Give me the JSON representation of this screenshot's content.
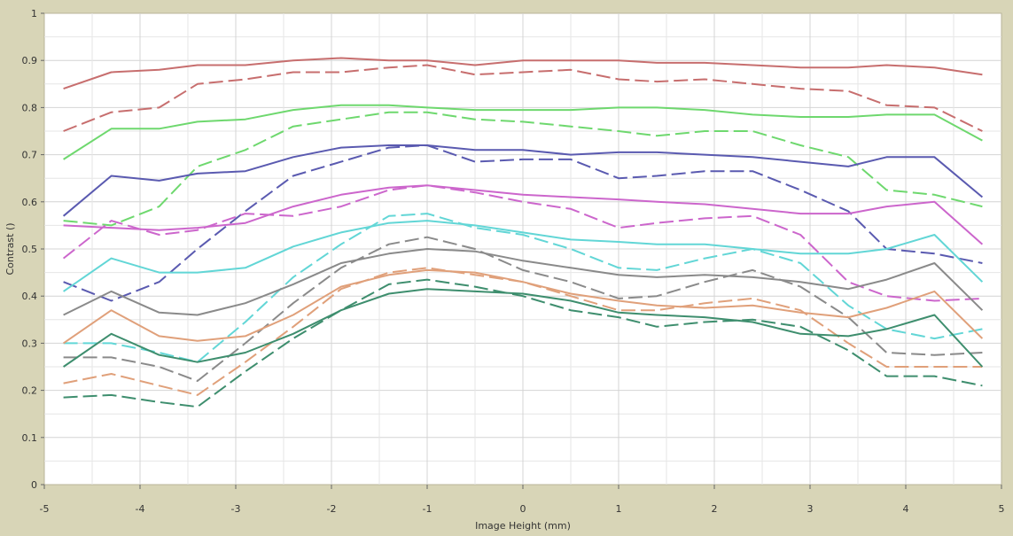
{
  "chart_data": {
    "type": "line",
    "title": "",
    "xlabel": "Image Height (mm)",
    "ylabel": "Contrast ()",
    "xlim": [
      -5,
      5
    ],
    "ylim": [
      0,
      1
    ],
    "x_ticks": [
      "-5",
      "-4",
      "-3",
      "-2",
      "-1",
      "0",
      "1",
      "2",
      "3",
      "4",
      "5"
    ],
    "y_ticks": [
      "0",
      "0.1",
      "0.2",
      "0.3",
      "0.4",
      "0.5",
      "0.6",
      "0.7",
      "0.8",
      "0.9",
      "1"
    ],
    "grid": true,
    "legend": "none",
    "x": [
      -4.8,
      -4.3,
      -3.8,
      -3.4,
      -2.9,
      -2.4,
      -1.9,
      -1.4,
      -1.0,
      -0.5,
      0.0,
      0.5,
      1.0,
      1.4,
      1.9,
      2.4,
      2.9,
      3.4,
      3.8,
      4.3,
      4.8
    ],
    "series": [
      {
        "color": "#c76e6e",
        "dash": false,
        "values": [
          0.84,
          0.875,
          0.88,
          0.89,
          0.89,
          0.9,
          0.905,
          0.9,
          0.9,
          0.89,
          0.9,
          0.9,
          0.9,
          0.895,
          0.895,
          0.89,
          0.885,
          0.885,
          0.89,
          0.885,
          0.87
        ]
      },
      {
        "color": "#c76e6e",
        "dash": true,
        "values": [
          0.75,
          0.79,
          0.8,
          0.85,
          0.86,
          0.875,
          0.875,
          0.885,
          0.89,
          0.87,
          0.875,
          0.88,
          0.86,
          0.855,
          0.86,
          0.85,
          0.84,
          0.835,
          0.805,
          0.8,
          0.75
        ]
      },
      {
        "color": "#6ed86e",
        "dash": false,
        "values": [
          0.69,
          0.755,
          0.755,
          0.77,
          0.775,
          0.795,
          0.805,
          0.805,
          0.8,
          0.795,
          0.795,
          0.795,
          0.8,
          0.8,
          0.795,
          0.785,
          0.78,
          0.78,
          0.785,
          0.785,
          0.73
        ]
      },
      {
        "color": "#6ed86e",
        "dash": true,
        "values": [
          0.56,
          0.55,
          0.59,
          0.675,
          0.71,
          0.76,
          0.775,
          0.79,
          0.79,
          0.775,
          0.77,
          0.76,
          0.75,
          0.74,
          0.75,
          0.75,
          0.72,
          0.695,
          0.625,
          0.615,
          0.59
        ]
      },
      {
        "color": "#5a5ab0",
        "dash": false,
        "values": [
          0.57,
          0.655,
          0.645,
          0.66,
          0.665,
          0.695,
          0.715,
          0.72,
          0.72,
          0.71,
          0.71,
          0.7,
          0.705,
          0.705,
          0.7,
          0.695,
          0.685,
          0.675,
          0.695,
          0.695,
          0.61
        ]
      },
      {
        "color": "#5a5ab0",
        "dash": true,
        "values": [
          0.43,
          0.39,
          0.43,
          0.5,
          0.58,
          0.655,
          0.685,
          0.715,
          0.72,
          0.685,
          0.69,
          0.69,
          0.65,
          0.655,
          0.665,
          0.665,
          0.625,
          0.58,
          0.5,
          0.49,
          0.47
        ]
      },
      {
        "color": "#cc66cc",
        "dash": false,
        "values": [
          0.55,
          0.545,
          0.54,
          0.545,
          0.555,
          0.59,
          0.615,
          0.63,
          0.635,
          0.625,
          0.615,
          0.61,
          0.605,
          0.6,
          0.595,
          0.585,
          0.575,
          0.575,
          0.59,
          0.6,
          0.51
        ]
      },
      {
        "color": "#cc66cc",
        "dash": true,
        "values": [
          0.48,
          0.56,
          0.53,
          0.54,
          0.575,
          0.57,
          0.59,
          0.625,
          0.635,
          0.62,
          0.6,
          0.585,
          0.545,
          0.555,
          0.565,
          0.57,
          0.53,
          0.43,
          0.4,
          0.39,
          0.395
        ]
      },
      {
        "color": "#62d6d6",
        "dash": false,
        "values": [
          0.41,
          0.48,
          0.45,
          0.45,
          0.46,
          0.505,
          0.535,
          0.555,
          0.56,
          0.55,
          0.535,
          0.52,
          0.515,
          0.51,
          0.51,
          0.5,
          0.49,
          0.49,
          0.5,
          0.53,
          0.43
        ]
      },
      {
        "color": "#62d6d6",
        "dash": true,
        "values": [
          0.3,
          0.3,
          0.28,
          0.26,
          0.345,
          0.44,
          0.51,
          0.57,
          0.575,
          0.545,
          0.53,
          0.5,
          0.46,
          0.455,
          0.48,
          0.5,
          0.47,
          0.38,
          0.33,
          0.31,
          0.33
        ]
      },
      {
        "color": "#8a8a8a",
        "dash": false,
        "values": [
          0.36,
          0.41,
          0.365,
          0.36,
          0.385,
          0.425,
          0.47,
          0.49,
          0.5,
          0.495,
          0.475,
          0.46,
          0.445,
          0.44,
          0.445,
          0.44,
          0.43,
          0.415,
          0.435,
          0.47,
          0.37
        ]
      },
      {
        "color": "#8a8a8a",
        "dash": true,
        "values": [
          0.27,
          0.27,
          0.25,
          0.22,
          0.3,
          0.385,
          0.46,
          0.51,
          0.525,
          0.5,
          0.455,
          0.43,
          0.395,
          0.4,
          0.43,
          0.455,
          0.42,
          0.355,
          0.28,
          0.275,
          0.28
        ]
      },
      {
        "color": "#e0a07a",
        "dash": false,
        "values": [
          0.3,
          0.37,
          0.315,
          0.305,
          0.315,
          0.36,
          0.42,
          0.445,
          0.455,
          0.45,
          0.43,
          0.405,
          0.39,
          0.38,
          0.375,
          0.38,
          0.365,
          0.355,
          0.375,
          0.41,
          0.31
        ]
      },
      {
        "color": "#e0a07a",
        "dash": true,
        "values": [
          0.215,
          0.235,
          0.21,
          0.19,
          0.26,
          0.335,
          0.415,
          0.45,
          0.46,
          0.445,
          0.43,
          0.4,
          0.37,
          0.37,
          0.385,
          0.395,
          0.37,
          0.3,
          0.25,
          0.25,
          0.25
        ]
      },
      {
        "color": "#3e8e6e",
        "dash": false,
        "values": [
          0.25,
          0.32,
          0.275,
          0.26,
          0.28,
          0.32,
          0.37,
          0.405,
          0.415,
          0.41,
          0.405,
          0.39,
          0.365,
          0.36,
          0.355,
          0.345,
          0.32,
          0.315,
          0.33,
          0.36,
          0.25
        ]
      },
      {
        "color": "#3e8e6e",
        "dash": true,
        "values": [
          0.185,
          0.19,
          0.175,
          0.165,
          0.24,
          0.31,
          0.37,
          0.425,
          0.435,
          0.42,
          0.4,
          0.37,
          0.355,
          0.335,
          0.345,
          0.35,
          0.335,
          0.285,
          0.23,
          0.23,
          0.21
        ]
      }
    ]
  }
}
